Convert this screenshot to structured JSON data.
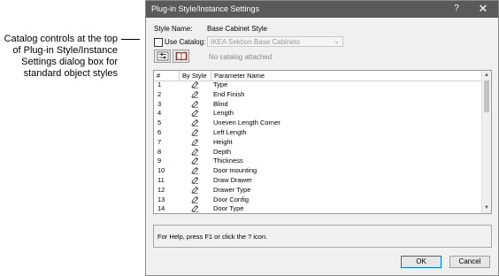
{
  "annotation": {
    "text": "Catalog controls at the top of Plug-in Style/Instance Settings dialog box for standard object styles"
  },
  "dialog": {
    "title": "Plug-in Style/Instance Settings",
    "help_glyph": "?",
    "close_glyph": "✕",
    "style_name_label": "Style Name:",
    "style_name_value": "Base Cabinet Style",
    "use_catalog_label": "Use Catalog:",
    "use_catalog_checked": false,
    "catalog_value": "IKEA Sektion Base Cabinets",
    "catalog_placeholder_note": "No catalog attached",
    "icons": [
      "catalog-options-icon",
      "catalog-book-icon"
    ],
    "help_text": "For Help, press F1 or click the ? icon.",
    "ok_label": "OK",
    "cancel_label": "Cancel"
  },
  "parameters": {
    "columns": [
      "#",
      "By Style",
      "Parameter Name"
    ],
    "rows": [
      {
        "num": "1",
        "name": "Type"
      },
      {
        "num": "2",
        "name": "End Finish"
      },
      {
        "num": "3",
        "name": "Blind"
      },
      {
        "num": "4",
        "name": "Length"
      },
      {
        "num": "5",
        "name": "Uneven Length Corner"
      },
      {
        "num": "6",
        "name": "Left Length"
      },
      {
        "num": "7",
        "name": "Height"
      },
      {
        "num": "8",
        "name": "Depth"
      },
      {
        "num": "9",
        "name": "Thickness"
      },
      {
        "num": "10",
        "name": "Door mounting"
      },
      {
        "num": "11",
        "name": "Draw Drawer"
      },
      {
        "num": "12",
        "name": "Drawer Type"
      },
      {
        "num": "13",
        "name": "Door Config"
      },
      {
        "num": "14",
        "name": "Door Type"
      }
    ]
  }
}
